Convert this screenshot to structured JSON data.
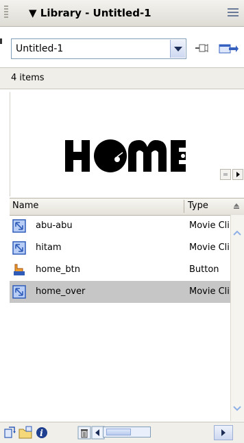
{
  "panel": {
    "title": "▼ Library - Untitled-1"
  },
  "library_select": {
    "value": "Untitled-1"
  },
  "count": {
    "text": "4 items"
  },
  "preview": {
    "graphic_text": "HOME"
  },
  "columns": {
    "name": "Name",
    "type": "Type"
  },
  "items": [
    {
      "name": "abu-abu",
      "type": "Movie Clip",
      "icon": "movie-clip-icon",
      "selected": false
    },
    {
      "name": "hitam",
      "type": "Movie Clip",
      "icon": "movie-clip-icon",
      "selected": false
    },
    {
      "name": "home_btn",
      "type": "Button",
      "icon": "button-symbol-icon",
      "selected": false
    },
    {
      "name": "home_over",
      "type": "Movie Clip",
      "icon": "movie-clip-icon",
      "selected": true
    }
  ],
  "colors": {
    "selected_row": "#c6c6c6",
    "accent": "#3560c0"
  }
}
